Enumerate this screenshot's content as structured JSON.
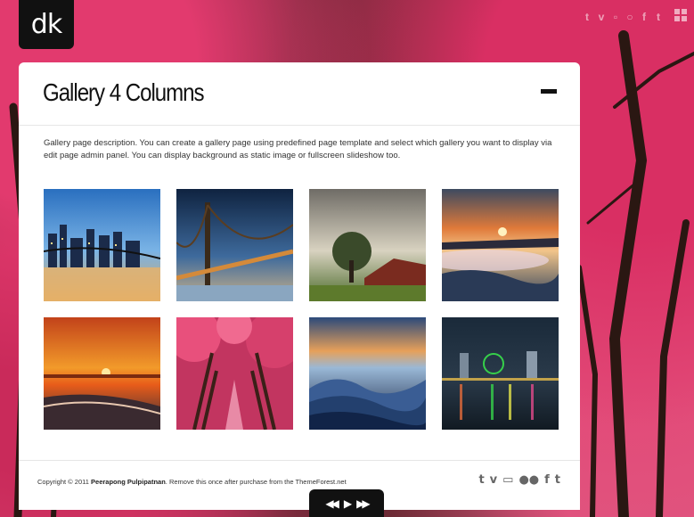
{
  "logo": {
    "text": "dk"
  },
  "top_social": [
    "t",
    "v",
    "▫",
    "○",
    "f",
    "t"
  ],
  "header": {
    "title": "Gallery 4 Columns"
  },
  "description": "Gallery page description. You can create a gallery page using predefined page template and select which gallery you want to display via edit page admin panel. You can display background as static image or fullscreen slideshow too.",
  "gallery": {
    "items": [
      {
        "name": "city-skyline-night",
        "icon": "photo"
      },
      {
        "name": "bridge-night",
        "icon": "photo"
      },
      {
        "name": "farmhouse-tree",
        "icon": "photo"
      },
      {
        "name": "misty-sunset",
        "icon": "photo"
      },
      {
        "name": "beach-sunset",
        "icon": "photo"
      },
      {
        "name": "pink-tree-avenue",
        "icon": "photo"
      },
      {
        "name": "blue-mountains",
        "icon": "photo"
      },
      {
        "name": "waterfront-night",
        "icon": "photo"
      }
    ]
  },
  "footer": {
    "copyright_prefix": "Copyright © 2011 ",
    "copyright_author": "Peerapong Pulpipatnan",
    "copyright_suffix": ". Remove this once after purchase from the ThemeForest.net",
    "social": [
      "t",
      "v",
      "▭",
      "●●",
      "f",
      "t"
    ]
  },
  "player": {
    "prev": "◀◀",
    "play": "▶",
    "next": "▶▶"
  }
}
